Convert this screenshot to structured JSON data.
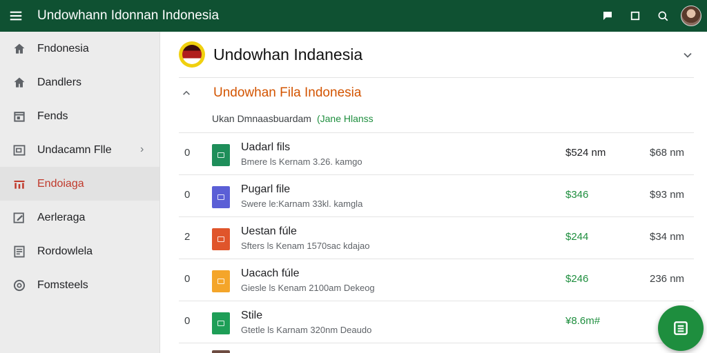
{
  "app": {
    "title": "Undowhann Idonnan Indonesia"
  },
  "colors": {
    "appbar": "#0f5132",
    "accent_green": "#1e8e3e",
    "accent_orange": "#d35400",
    "active_red": "#c0392b"
  },
  "appbar_actions": [
    {
      "icon": "chat-bubble-icon"
    },
    {
      "icon": "square-icon"
    },
    {
      "icon": "search-icon"
    },
    {
      "icon": "avatar"
    }
  ],
  "sidebar": {
    "items": [
      {
        "label": "Fndonesia",
        "icon": "home-icon",
        "active": false
      },
      {
        "label": "Dandlers",
        "icon": "home-icon",
        "active": false
      },
      {
        "label": "Fends",
        "icon": "calendar-icon",
        "active": false
      },
      {
        "label": "Undacamn Flle",
        "icon": "folder-file-icon",
        "active": false,
        "has_chevron": true
      },
      {
        "label": "Endoiaga",
        "icon": "bar-chart-icon",
        "active": true
      },
      {
        "label": "Aerleraga",
        "icon": "edit-document-icon",
        "active": false
      },
      {
        "label": "Rordowlela",
        "icon": "list-document-icon",
        "active": false
      },
      {
        "label": "Fomsteels",
        "icon": "circle-settings-icon",
        "active": false
      }
    ]
  },
  "main": {
    "header": {
      "title": "Undowhan Indanesia"
    },
    "section": {
      "title": "Undowhan Fila Indonesia",
      "subheading": "Ukan Dmnaasbuardam",
      "subheading_tag": "(Jane Hlanss"
    },
    "rows": [
      {
        "num": "0",
        "name": "Uadarl fils",
        "meta": "Bmere ls Kernam 3.26. kamgo",
        "price": "$524 nm",
        "price_color": "#202124",
        "size": "$68 nm",
        "icon_color": "#1e8e5a"
      },
      {
        "num": "0",
        "name": "Pugarl file",
        "meta": "Swere le:Karnam 33kl. kamgla",
        "price": "$346",
        "price_color": "#1e8e3e",
        "size": "$93 nm",
        "icon_color": "#5b5fd6"
      },
      {
        "num": "2",
        "name": "Uestan fúle",
        "meta": "Sfters ls Kenam 1570sac kdajao",
        "price": "$244",
        "price_color": "#1e8e3e",
        "size": "$34 nm",
        "icon_color": "#e0552b"
      },
      {
        "num": "0",
        "name": "Uacach fúle",
        "meta": "Giesle ls Kenam 2100am Dekeog",
        "price": "$246",
        "price_color": "#1e8e3e",
        "size": "236 nm",
        "icon_color": "#f4a52a"
      },
      {
        "num": "0",
        "name": "Stile",
        "meta": "Gtetle ls Karnam 320nm Deaudo",
        "price": "¥8.6m#",
        "price_color": "#1e8e3e",
        "size": "",
        "icon_color": "#1e9e57"
      }
    ]
  },
  "fab": {
    "icon": "list-icon"
  }
}
